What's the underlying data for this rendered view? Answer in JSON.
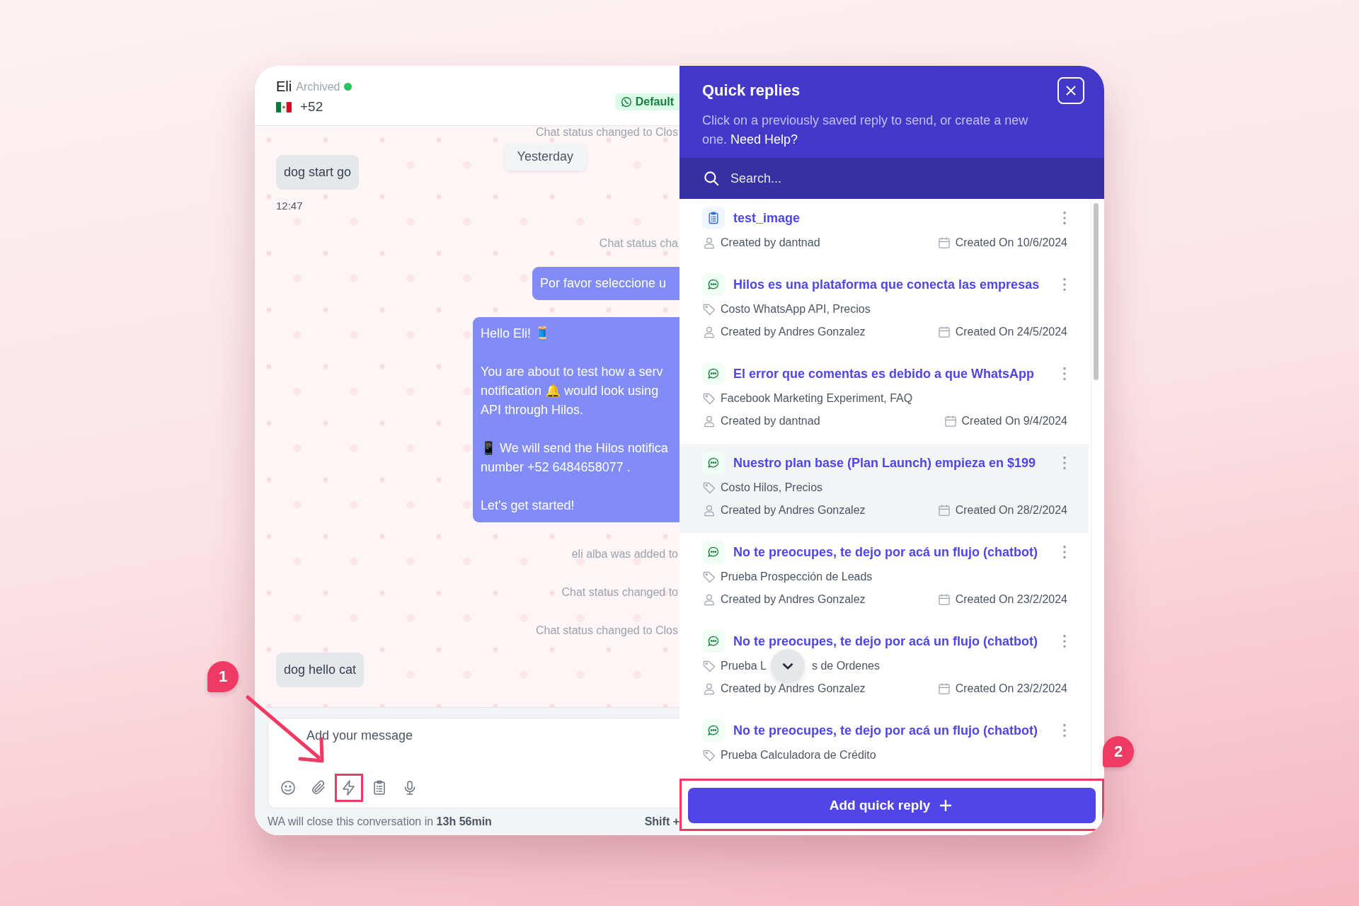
{
  "chat": {
    "contact": {
      "name": "Eli",
      "status": "Archived",
      "online": true,
      "phone": "+52"
    },
    "channel_badge": "Default",
    "messages": [
      {
        "kind": "system",
        "text": "Chat status changed to Clos"
      },
      {
        "kind": "date",
        "text": "Yesterday"
      },
      {
        "kind": "incoming",
        "text": "dog start go",
        "time": "12:47"
      },
      {
        "kind": "system",
        "text": "Chat status cha"
      },
      {
        "kind": "outgoing",
        "paragraphs": [
          [
            "Por favor seleccione u"
          ]
        ]
      },
      {
        "kind": "outgoing",
        "paragraphs": [
          [
            "Hello Eli! 🧵"
          ],
          [
            "You are about to test how a serv",
            "notification 🔔 would look using",
            "API through Hilos."
          ],
          [
            "📱 We will send the Hilos notifica",
            "number +52 6484658077 ."
          ],
          [
            "Let's get started!"
          ]
        ]
      },
      {
        "kind": "system",
        "text": "eli alba was added to"
      },
      {
        "kind": "system",
        "text": "Chat status changed to"
      },
      {
        "kind": "system",
        "text": "Chat status changed to Clos"
      },
      {
        "kind": "incoming",
        "text": "dog hello cat"
      }
    ],
    "composer": {
      "placeholder": "Add your message",
      "tools": [
        {
          "kind": "emoji",
          "annotated": false
        },
        {
          "kind": "attach",
          "annotated": false
        },
        {
          "kind": "quick_reply",
          "annotated": true
        },
        {
          "kind": "template",
          "annotated": false
        },
        {
          "kind": "voice",
          "annotated": false
        }
      ]
    },
    "footer": {
      "notice": "WA will close this conversation in **13h 56min**",
      "shortcut": "Shift +"
    }
  },
  "quick_replies": {
    "title": "Quick replies",
    "description": "Click on a previously saved reply to send, or create a new one.",
    "help_link": "Need Help?",
    "search_placeholder": "Search...",
    "items": [
      {
        "kind": "template",
        "title": "test_image",
        "author": "Created by dantnad",
        "date": "Created On 10/6/2024",
        "selected": false
      },
      {
        "kind": "message",
        "title": "Hilos es una plataforma que conecta las empresas",
        "tag_parts": [
          "Costo WhatsApp API, Precios"
        ],
        "author": "Created by Andres Gonzalez",
        "date": "Created On 24/5/2024",
        "selected": false
      },
      {
        "kind": "message",
        "title": "El error que comentas es debido a que WhatsApp",
        "tag_parts": [
          "Facebook Marketing Experiment, FAQ"
        ],
        "author": "Created by dantnad",
        "date": "Created On 9/4/2024",
        "selected": false
      },
      {
        "kind": "message",
        "title": "Nuestro plan base (Plan Launch) empieza en $199",
        "tag_parts": [
          "Costo Hilos, Precios"
        ],
        "author": "Created by Andres Gonzalez",
        "date": "Created On 28/2/2024",
        "selected": true
      },
      {
        "kind": "message",
        "title": "No te preocupes, te dejo por acá un flujo (chatbot)",
        "tag_parts": [
          "Prueba Prospección de Leads"
        ],
        "author": "Created by Andres Gonzalez",
        "date": "Created On 23/2/2024",
        "selected": false
      },
      {
        "kind": "message",
        "title": "No te preocupes, te dejo por acá un flujo (chatbot)",
        "tag_parts": [
          "Prueba L",
          "s de Ordenes"
        ],
        "author": "Created by Andres Gonzalez",
        "date": "Created On 23/2/2024",
        "selected": false
      },
      {
        "kind": "message",
        "title": "No te preocupes, te dejo por acá un flujo (chatbot)",
        "tag_parts": [
          "Prueba Calculadora de Crédito"
        ],
        "selected": false
      }
    ],
    "add_button": {
      "label": "Add quick reply",
      "annotated": true
    }
  },
  "annotations": [
    {
      "label": "1"
    },
    {
      "label": "2"
    }
  ]
}
